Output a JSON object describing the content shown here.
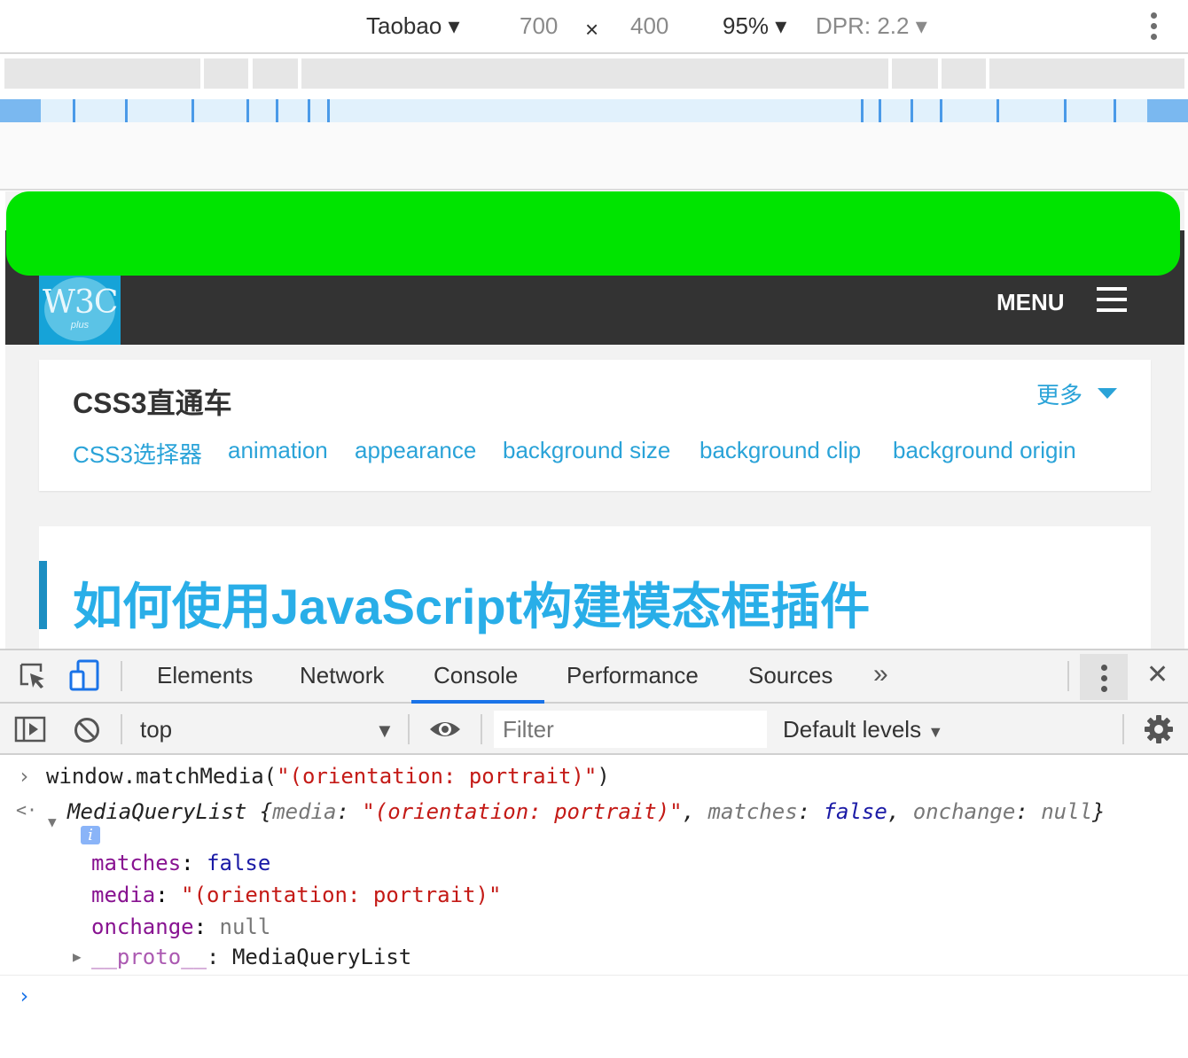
{
  "device_toolbar": {
    "device": "Taobao",
    "width": "700",
    "times": "×",
    "height": "400",
    "zoom": "95%",
    "dpr": "DPR: 2.2"
  },
  "site": {
    "logo_text": "W3C",
    "logo_sub": "plus",
    "menu_label": "MENU",
    "card": {
      "title": "CSS3直通车",
      "more": "更多",
      "tags": [
        "CSS3选择器",
        "animation",
        "appearance",
        "background size",
        "background clip",
        "background origin"
      ]
    },
    "article_title": "如何使用JavaScript构建模态框插件"
  },
  "devtools": {
    "tabs": [
      "Elements",
      "Network",
      "Console",
      "Performance",
      "Sources"
    ],
    "overflow": "»",
    "close": "✕",
    "context": "top",
    "filter_placeholder": "Filter",
    "levels": "Default levels",
    "console": {
      "input": "window.matchMedia(\"(orientation: portrait)\")",
      "result_type": "MediaQueryList",
      "info_badge": "i",
      "props": [
        {
          "key": "matches",
          "value": "false"
        },
        {
          "key": "media",
          "value": "\"(orientation: portrait)\""
        },
        {
          "key": "onchange",
          "value": "null"
        },
        {
          "key": "__proto__",
          "value": "MediaQueryList"
        }
      ]
    }
  }
}
